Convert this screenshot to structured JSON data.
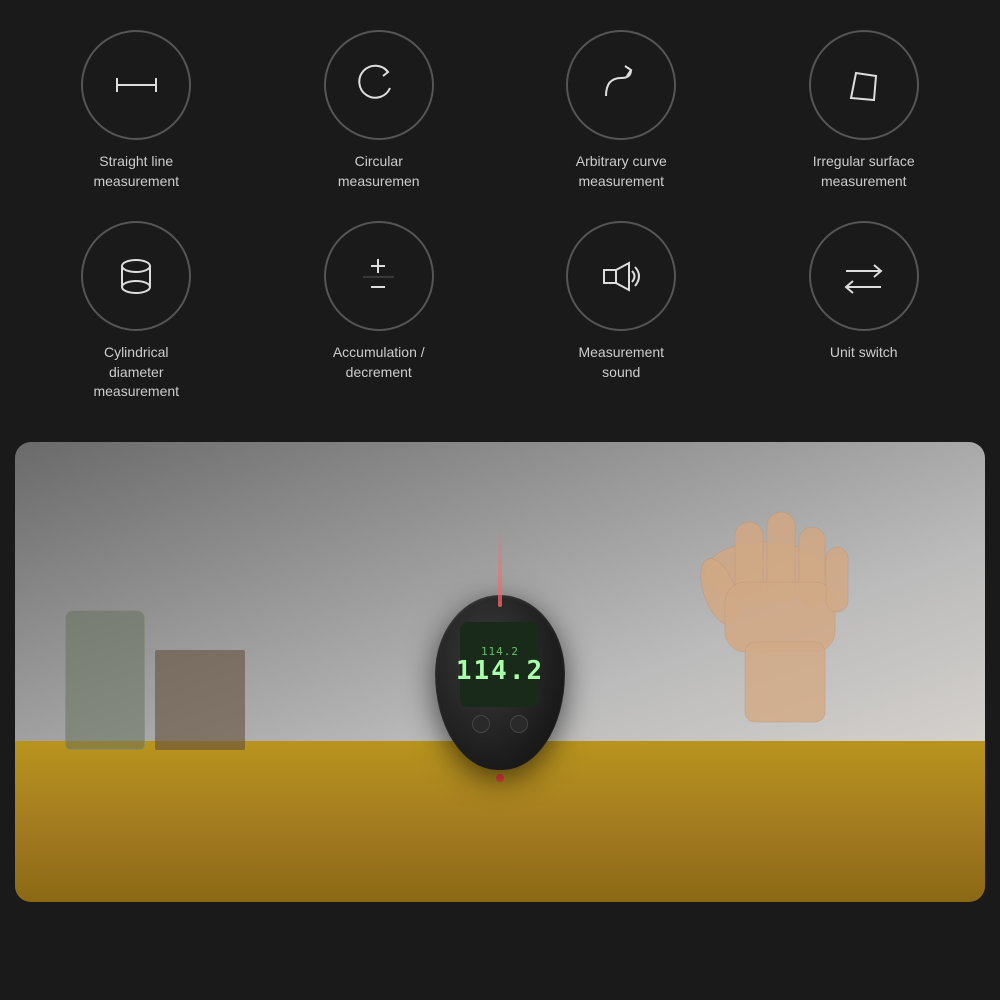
{
  "background": "#1a1a1a",
  "icons_row1": [
    {
      "id": "straight-line",
      "label": "Straight line\nmeasurement",
      "label_line1": "Straight line",
      "label_line2": "measurement",
      "icon_type": "straight-line"
    },
    {
      "id": "circular",
      "label": "Circular\nmeasuremen",
      "label_line1": "Circular",
      "label_line2": "measuremen",
      "icon_type": "circular"
    },
    {
      "id": "arbitrary-curve",
      "label": "Arbitrary curve\nmeasurement",
      "label_line1": "Arbitrary curve",
      "label_line2": "measurement",
      "icon_type": "arbitrary-curve"
    },
    {
      "id": "irregular-surface",
      "label": "Irregular surface\nmeasurement",
      "label_line1": "Irregular surface",
      "label_line2": "measurement",
      "icon_type": "irregular-surface"
    }
  ],
  "icons_row2": [
    {
      "id": "cylindrical",
      "label": "Cylindrical\ndiameter\nmeasurement",
      "label_line1": "Cylindrical",
      "label_line2": "diameter",
      "label_line3": "measurement",
      "icon_type": "cylindrical"
    },
    {
      "id": "accumulation",
      "label": "Accumulation /\ndecrement",
      "label_line1": "Accumulation /",
      "label_line2": "decrement",
      "icon_type": "accumulation"
    },
    {
      "id": "measurement-sound",
      "label": "Measurement\nsound",
      "label_line1": "Measurement",
      "label_line2": "sound",
      "icon_type": "sound"
    },
    {
      "id": "unit-switch",
      "label": "Unit switch",
      "label_line1": "Unit switch",
      "icon_type": "unit-switch"
    }
  ],
  "device": {
    "display_top": "114.2",
    "display_main": "114.2"
  }
}
